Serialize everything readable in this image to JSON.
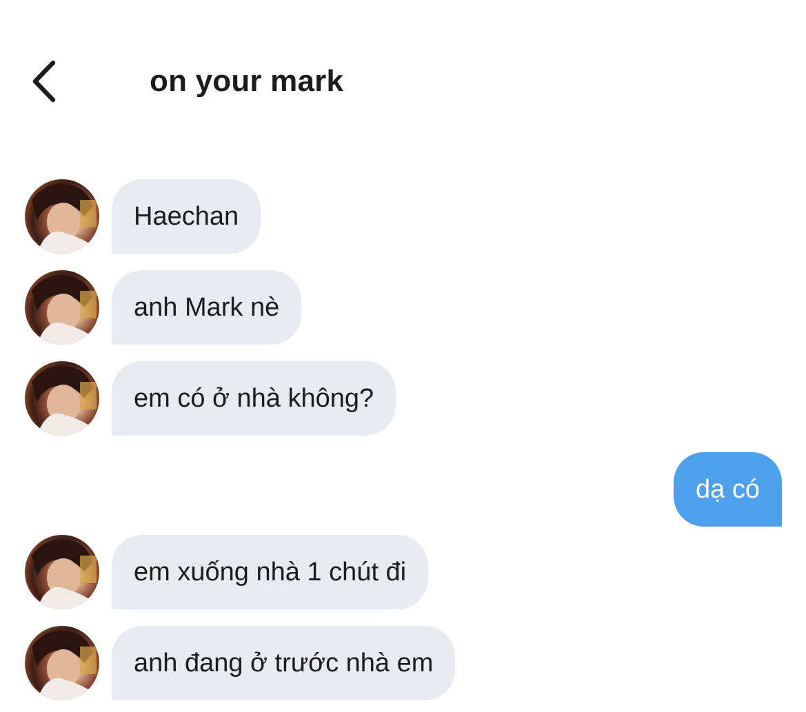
{
  "header": {
    "back_icon": "chevron-left-icon",
    "title": "on your mark"
  },
  "messages": [
    {
      "sender": "incoming",
      "text": "Haechan"
    },
    {
      "sender": "incoming",
      "text": "anh Mark nè"
    },
    {
      "sender": "incoming",
      "text": "em có ở nhà không?"
    },
    {
      "sender": "outgoing",
      "text": "dạ có"
    },
    {
      "sender": "incoming",
      "text": "em xuống nhà 1 chút đi"
    },
    {
      "sender": "incoming",
      "text": "anh đang ở trước nhà em"
    }
  ],
  "colors": {
    "incoming_bubble": "#e8ebf0",
    "outgoing_bubble": "#4da0ea",
    "text": "#1c1c1e"
  }
}
